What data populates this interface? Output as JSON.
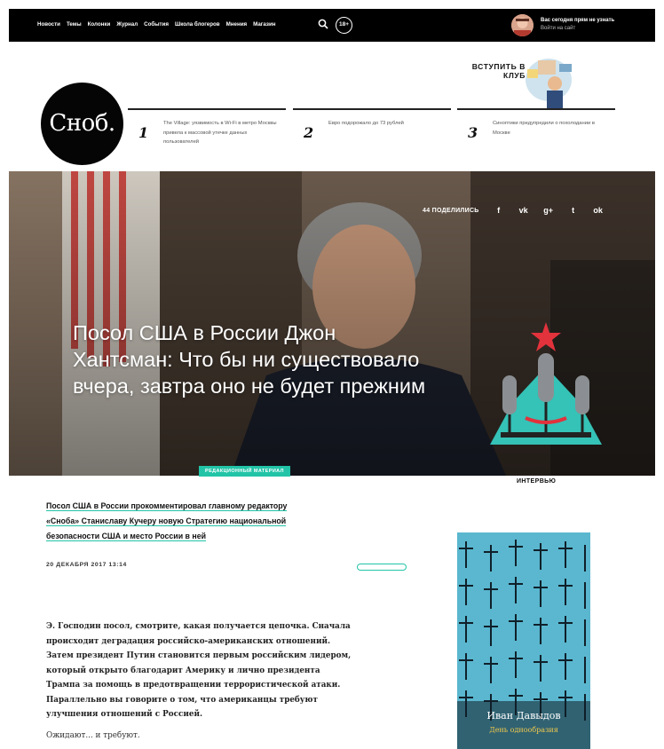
{
  "nav": {
    "items": [
      "Новости",
      "Темы",
      "Колонки",
      "Журнал",
      "События",
      "Школа блогеров",
      "Мнения",
      "Магазин"
    ],
    "age_rating": "18+",
    "user": {
      "line1": "Вас сегодня прям не узнать",
      "line2": "Войти на сайт"
    }
  },
  "header": {
    "logo": "Сноб.",
    "club_banner": "ВСТУПИТЬ В КЛУБ",
    "top_news": [
      {
        "num": "1",
        "text": "The Village: уязвимость в Wi-Fi в метро Москвы привела к массовой утечке данных пользователей"
      },
      {
        "num": "2",
        "text": "Евро подорожало до 73 рублей"
      },
      {
        "num": "3",
        "text": "Синоптики предупредили о похолодании в Москве"
      }
    ]
  },
  "hero": {
    "share_count": "44 ПОДЕЛИЛИСЬ",
    "share_icons": [
      "f",
      "vk",
      "g+",
      "t",
      "ok"
    ],
    "title": "Посол США в России Джон Хантсман: Что бы ни существовало вчера, завтра оно не будет прежним",
    "editorial_tag": "РЕДАКЦИОННЫЙ МАТЕРИАЛ",
    "rubric": "ИНТЕРВЬЮ"
  },
  "article": {
    "lead_lines": [
      "Посол США в России прокомментировал главному редактору",
      "«Сноба» Станиславу Кучеру новую Стратегию национальной",
      "безопасности США и место России в ней"
    ],
    "date": "20 ДЕКАБРЯ 2017 13:14",
    "body_lines": [
      "Э. Господин посол, смотрите, какая получается цепочка. Сначала",
      "происходит деградация российско-американских отношений.",
      "Затем президент Путин становится первым российским лидером,",
      "который открыто благодарит Америку и лично президента",
      "Трампа за помощь в предотвращении террористической атаки.",
      "Параллельно вы говорите о том, что американцы требуют",
      "улучшения отношений с Россией."
    ],
    "body_tail": "Ожидают... и требуют."
  },
  "book_promo": {
    "author": "Иван Давыдов",
    "title": "День однообразия"
  },
  "colors": {
    "accent": "#22c4a7",
    "nav_bg": "#000000",
    "book_bg": "#5ab7cf"
  }
}
